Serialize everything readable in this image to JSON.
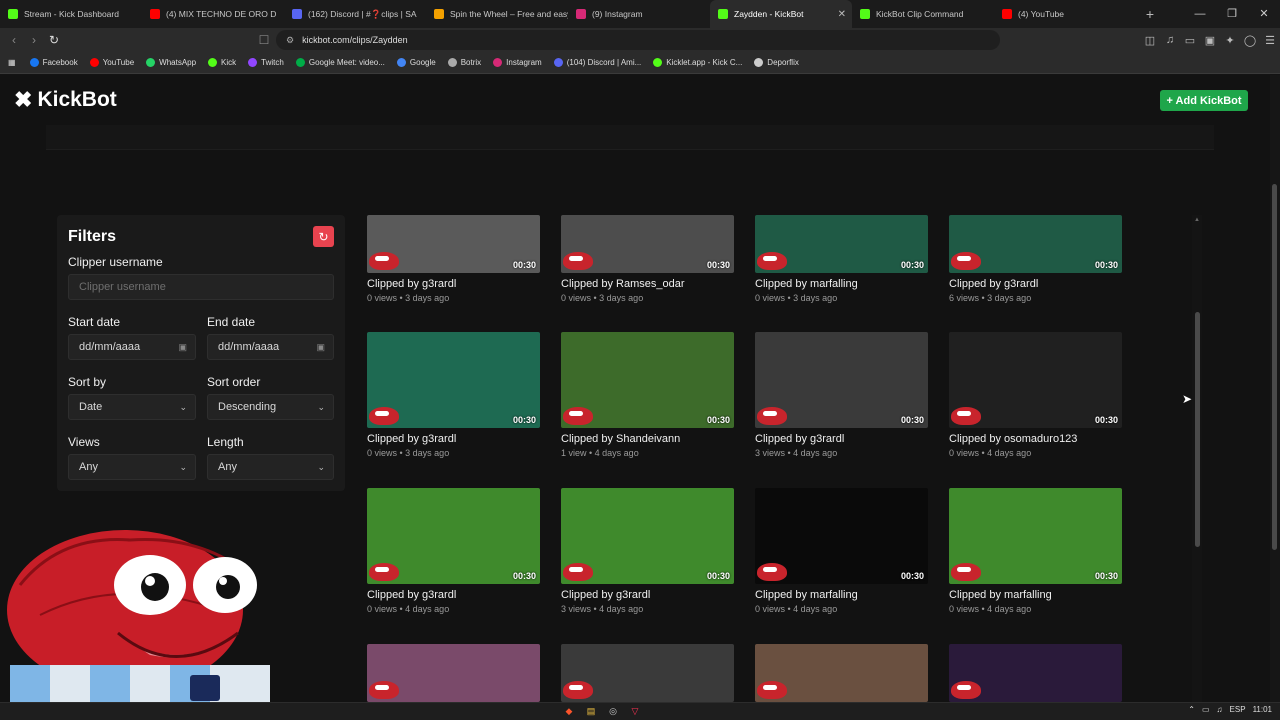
{
  "browser": {
    "tabs": [
      {
        "title": "Stream - Kick Dashboard",
        "color": "#53fc18"
      },
      {
        "title": "(4) MIX TECHNO DE ORO D",
        "color": "#ff0000"
      },
      {
        "title": "(162) Discord | #❓clips | SA",
        "color": "#5865f2"
      },
      {
        "title": "Spin the Wheel – Free and easy",
        "color": "#f4a100"
      },
      {
        "title": "(9) Instagram",
        "color": "#d62976"
      },
      {
        "title": "Zaydden - KickBot",
        "color": "#53fc18",
        "active": true
      },
      {
        "title": "KickBot Clip Command",
        "color": "#53fc18"
      },
      {
        "title": "(4) YouTube",
        "color": "#ff0000"
      }
    ],
    "tab_close": "✕",
    "new_tab": "+",
    "window_controls": [
      "—",
      "❐",
      "✕"
    ],
    "nav": {
      "back": "‹",
      "forward": "›",
      "reload": "↻",
      "bookmark": "☐"
    },
    "url": "kickbot.com/clips/Zaydden",
    "bookmarks": [
      {
        "label": "Facebook",
        "color": "#1877f2"
      },
      {
        "label": "YouTube",
        "color": "#ff0000"
      },
      {
        "label": "WhatsApp",
        "color": "#25d366"
      },
      {
        "label": "Kick",
        "color": "#53fc18"
      },
      {
        "label": "Twitch",
        "color": "#9146ff"
      },
      {
        "label": "Google Meet: video...",
        "color": "#00ac47"
      },
      {
        "label": "Google",
        "color": "#4285f4"
      },
      {
        "label": "Botrix",
        "color": "#aaaaaa"
      },
      {
        "label": "Instagram",
        "color": "#d62976"
      },
      {
        "label": "(104) Discord | Ami...",
        "color": "#5865f2"
      },
      {
        "label": "Kicklet.app - Kick C...",
        "color": "#53fc18"
      },
      {
        "label": "Deporflix",
        "color": "#cccccc"
      }
    ]
  },
  "app": {
    "logo_mark": "✖",
    "logo_text": "KickBot",
    "add_button": "+ Add KickBot",
    "accent": "#1fa64a"
  },
  "filters": {
    "title": "Filters",
    "reset_icon": "↻",
    "clipper_label": "Clipper username",
    "clipper_placeholder": "Clipper username",
    "start_label": "Start date",
    "start_value": "dd/mm/aaaa",
    "end_label": "End date",
    "end_value": "dd/mm/aaaa",
    "sort_by_label": "Sort by",
    "sort_by_value": "Date",
    "sort_order_label": "Sort order",
    "sort_order_value": "Descending",
    "views_label": "Views",
    "views_value": "Any",
    "length_label": "Length",
    "length_value": "Any",
    "calendar_icon": "▣",
    "chevron_icon": "⌄"
  },
  "clips": [
    {
      "title": "Clipped by g3rardl",
      "meta": "0 views • 3 days ago",
      "duration": "00:30",
      "bg": "#5a5a5a"
    },
    {
      "title": "Clipped by Ramses_odar",
      "meta": "0 views • 3 days ago",
      "duration": "00:30",
      "bg": "#4d4d4d"
    },
    {
      "title": "Clipped by marfalling",
      "meta": "0 views • 3 days ago",
      "duration": "00:30",
      "bg": "#1f5a45"
    },
    {
      "title": "Clipped by g3rardl",
      "meta": "6 views • 3 days ago",
      "duration": "00:30",
      "bg": "#1f5a45"
    },
    {
      "title": "Clipped by g3rardl",
      "meta": "0 views • 3 days ago",
      "duration": "00:30",
      "bg": "#1e6a52"
    },
    {
      "title": "Clipped by Shandeivann",
      "meta": "1 view • 4 days ago",
      "duration": "00:30",
      "bg": "#3d6b2a"
    },
    {
      "title": "Clipped by g3rardl",
      "meta": "3 views • 4 days ago",
      "duration": "00:30",
      "bg": "#3a3a3a"
    },
    {
      "title": "Clipped by osomaduro123",
      "meta": "0 views • 4 days ago",
      "duration": "00:30",
      "bg": "#202020"
    },
    {
      "title": "Clipped by g3rardl",
      "meta": "0 views • 4 days ago",
      "duration": "00:30",
      "bg": "#3f8a2c"
    },
    {
      "title": "Clipped by g3rardl",
      "meta": "3 views • 4 days ago",
      "duration": "00:30",
      "bg": "#3f8a2c"
    },
    {
      "title": "Clipped by marfalling",
      "meta": "0 views • 4 days ago",
      "duration": "00:30",
      "bg": "#0a0a0a"
    },
    {
      "title": "Clipped by marfalling",
      "meta": "0 views • 4 days ago",
      "duration": "00:30",
      "bg": "#3f8a2c"
    },
    {
      "bg": "#7a4a6a"
    },
    {
      "bg": "#3a3a3a"
    },
    {
      "bg": "#6a5040"
    },
    {
      "bg": "#2a1a3a"
    }
  ],
  "taskbar": {
    "apps": [
      "◆",
      "▤",
      "◎",
      "▽"
    ],
    "tray": [
      "⌃",
      "▭",
      "♫",
      "ESP",
      "11:01"
    ]
  }
}
